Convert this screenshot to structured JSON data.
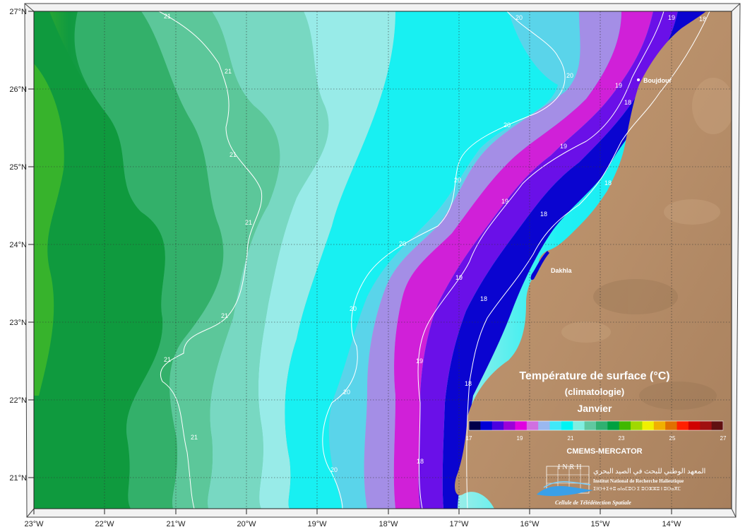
{
  "map": {
    "title_line1": "Température de surface (°C)",
    "title_line2": "(climatologie)",
    "title_line3": "Janvier",
    "source": "CMEMS-MERCATOR",
    "lon_labels": [
      "23°W",
      "22°W",
      "21°W",
      "20°W",
      "19°W",
      "18°W",
      "17°W",
      "16°W",
      "15°W",
      "14°W"
    ],
    "lat_labels": [
      "27°N",
      "26°N",
      "25°N",
      "24°N",
      "23°N",
      "22°N",
      "21°N"
    ],
    "cities": [
      {
        "name": "Boujdour"
      },
      {
        "name": "Dakhla"
      }
    ],
    "isotherm_labels": [
      "21",
      "21",
      "21",
      "21",
      "21",
      "21",
      "21",
      "20",
      "20",
      "20",
      "20",
      "20",
      "20",
      "19",
      "19",
      "19",
      "19",
      "19",
      "19",
      "18",
      "18",
      "18",
      "18",
      "18"
    ],
    "colorbar": {
      "labels": [
        "17",
        "19",
        "21",
        "23",
        "25",
        "27"
      ],
      "colors": [
        "#00004a",
        "#0000d6",
        "#4b00e0",
        "#9b00d8",
        "#e000e0",
        "#d070e0",
        "#9ab8f0",
        "#40e8f8",
        "#00f4f4",
        "#80eee0",
        "#60c8a0",
        "#30b070",
        "#00a040",
        "#40b800",
        "#a0d800",
        "#f0f000",
        "#f0b000",
        "#e07000",
        "#ff2000",
        "#d00000",
        "#a01010",
        "#601010"
      ]
    },
    "logo": {
      "acronym": "INRH",
      "arabic": "المعهد الوطني للبحث في الصيد البحري",
      "french": "Institut National de Recherche Halieutique",
      "tifinagh": "ⵉⵏⵙⵜⵉⵜⵓ ⴰⵏⴰⵎⵓⵔ ⵉ ⵓⵔⵣⵣⵓ ⵏ ⵓⵙⴰⴳⵎ",
      "unit": "Cellule de Télédétection Spatiale"
    }
  }
}
